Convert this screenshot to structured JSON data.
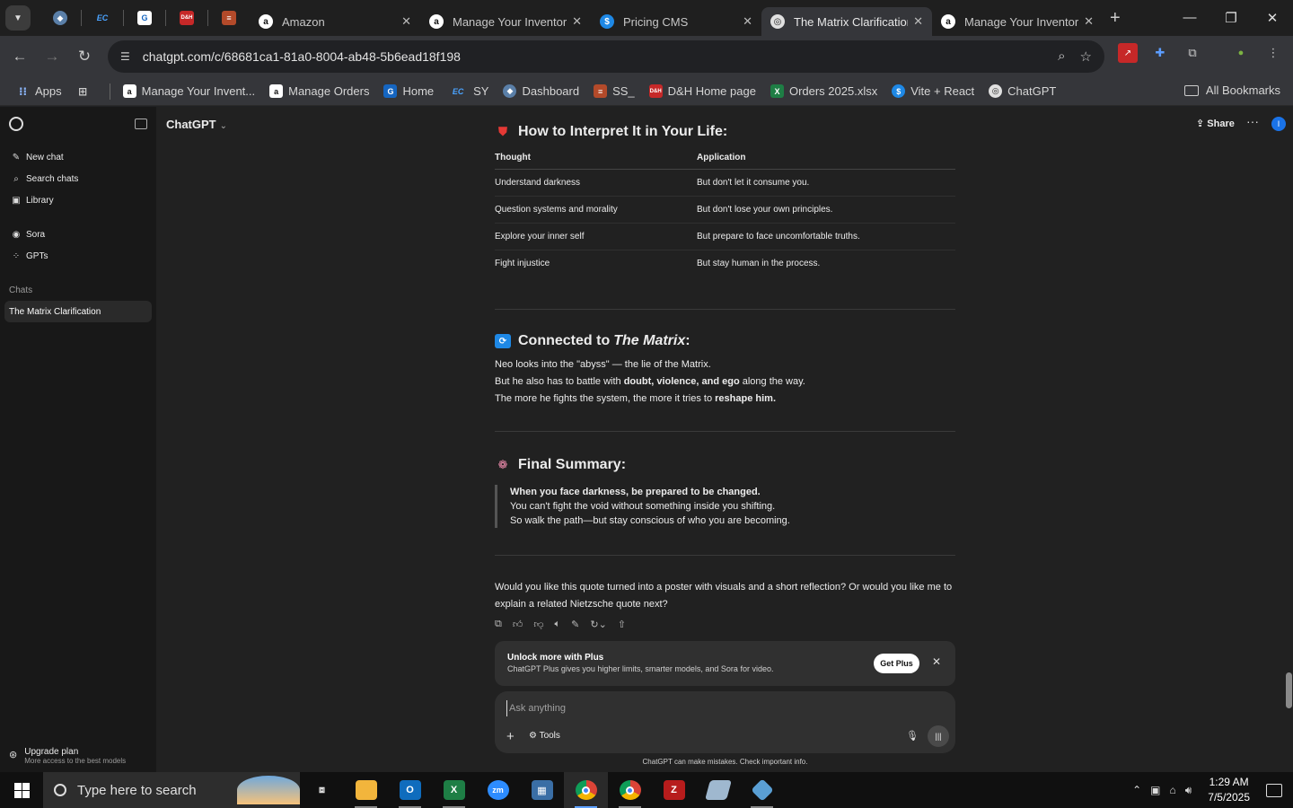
{
  "browser": {
    "tabs": [
      {
        "title": "Amazon",
        "favicon": "a",
        "color": "#ffffff"
      },
      {
        "title": "Manage Your Inventory",
        "favicon": "a",
        "color": "#ffffff"
      },
      {
        "title": "Pricing CMS",
        "favicon": "$",
        "color": "#1e88e5"
      },
      {
        "title": "The Matrix Clarification",
        "favicon": "◎",
        "color": "#e0e0e0",
        "active": true
      },
      {
        "title": "Manage Your Inventory",
        "favicon": "a",
        "color": "#ffffff"
      }
    ],
    "pinned_labels": [
      "EC",
      "D&H"
    ],
    "url": "chatgpt.com/c/68681ca1-81a0-8004-ab48-5b6ead18f198",
    "bookmarks": [
      {
        "label": "Apps",
        "icon": "apps-grid-icon"
      },
      {
        "label": "Manage Your Invent...",
        "icon": "amazon-icon"
      },
      {
        "label": "Manage Orders",
        "icon": "amazon-icon"
      },
      {
        "label": "Home",
        "icon": "home-icon"
      },
      {
        "label": "SY",
        "icon": "ec-icon"
      },
      {
        "label": "Dashboard",
        "icon": "dashboard-icon"
      },
      {
        "label": "SS_",
        "icon": "ss-icon"
      },
      {
        "label": "D&H Home page",
        "icon": "dh-icon"
      },
      {
        "label": "Orders 2025.xlsx",
        "icon": "excel-icon"
      },
      {
        "label": "Vite + React",
        "icon": "vite-icon"
      },
      {
        "label": "ChatGPT",
        "icon": "chatgpt-icon"
      }
    ],
    "all_bookmarks": "All Bookmarks"
  },
  "sidebar": {
    "items": [
      {
        "label": "New chat",
        "icon": "✎"
      },
      {
        "label": "Search chats",
        "icon": "⌕"
      },
      {
        "label": "Library",
        "icon": "▣"
      }
    ],
    "items2": [
      {
        "label": "Sora",
        "icon": "◉"
      },
      {
        "label": "GPTs",
        "icon": "⁘"
      }
    ],
    "chats_label": "Chats",
    "chats": [
      "The Matrix Clarification"
    ],
    "upgrade_title": "Upgrade plan",
    "upgrade_sub": "More access to the best models"
  },
  "header": {
    "model": "ChatGPT",
    "share": "Share",
    "avatar_letter": "I"
  },
  "conversation": {
    "section1_title": "How to Interpret It in Your Life:",
    "table_headers": [
      "Thought",
      "Application"
    ],
    "table_rows": [
      [
        "Understand darkness",
        "But don't let it consume you."
      ],
      [
        "Question systems and morality",
        "But don't lose your own principles."
      ],
      [
        "Explore your inner self",
        "But prepare to face uncomfortable truths."
      ],
      [
        "Fight injustice",
        "But stay human in the process."
      ]
    ],
    "section2_title_pre": "Connected to ",
    "section2_title_em": "The Matrix",
    "section2_title_post": ":",
    "section2_line1": "Neo looks into the \"abyss\" — the lie of the Matrix.",
    "section2_line2_pre": "But he also has to battle with ",
    "section2_line2_bold": "doubt, violence, and ego",
    "section2_line2_post": " along the way.",
    "section2_line3_pre": "The more he fights the system, the more it tries to ",
    "section2_line3_bold": "reshape him.",
    "section3_title": "Final Summary:",
    "quote_bold": "When you face darkness, be prepared to be changed.",
    "quote_line2": "You can't fight the void without something inside you shifting.",
    "quote_line3": "So walk the path—but stay conscious of who you are becoming.",
    "closing": "Would you like this quote turned into a poster with visuals and a short reflection? Or would you like me to explain a related Nietzsche quote next?"
  },
  "plus_banner": {
    "title": "Unlock more with Plus",
    "subtitle": "ChatGPT Plus gives you higher limits, smarter models, and Sora for video.",
    "button": "Get Plus"
  },
  "composer": {
    "placeholder": "Ask anything",
    "tools": "Tools"
  },
  "disclaimer": "ChatGPT can make mistakes. Check important info.",
  "taskbar": {
    "search_placeholder": "Type here to search",
    "time": "1:29 AM",
    "date": "7/5/2025"
  }
}
